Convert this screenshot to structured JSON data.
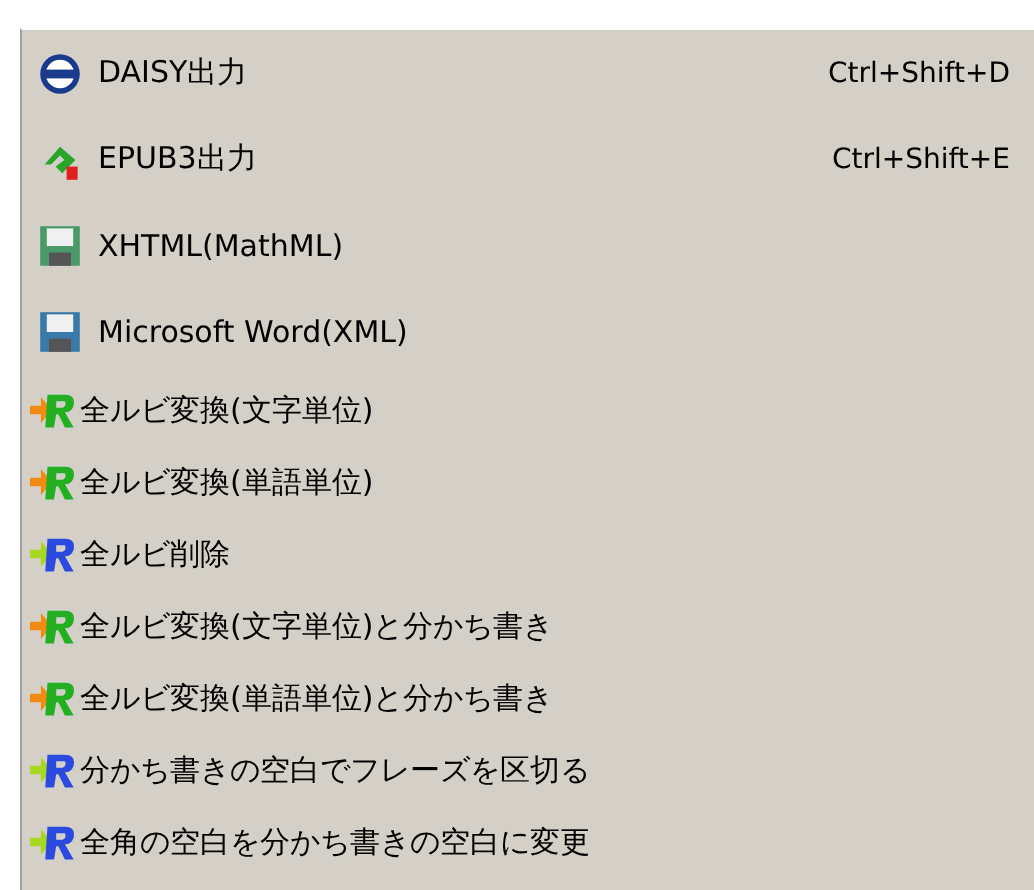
{
  "menu": {
    "items": [
      {
        "label": "DAISY出力",
        "shortcut": "Ctrl+Shift+D",
        "kind": "daisy"
      },
      {
        "label": "EPUB3出力",
        "shortcut": "Ctrl+Shift+E",
        "kind": "epub"
      },
      {
        "label": "XHTML(MathML)",
        "kind": "save-green"
      },
      {
        "label": "Microsoft Word(XML)",
        "kind": "save-blue"
      },
      {
        "label": "全ルビ変換(文字単位)",
        "kind": "ruby-green"
      },
      {
        "label": "全ルビ変換(単語単位)",
        "kind": "ruby-green"
      },
      {
        "label": "全ルビ削除",
        "kind": "ruby-blue"
      },
      {
        "label": "全ルビ変換(文字単位)と分かち書き",
        "kind": "ruby-green"
      },
      {
        "label": "全ルビ変換(単語単位)と分かち書き",
        "kind": "ruby-green"
      },
      {
        "label": "分かち書きの空白でフレーズを区切る",
        "kind": "ruby-blue"
      },
      {
        "label": "全角の空白を分かち書きの空白に変更",
        "kind": "ruby-blue"
      }
    ]
  }
}
